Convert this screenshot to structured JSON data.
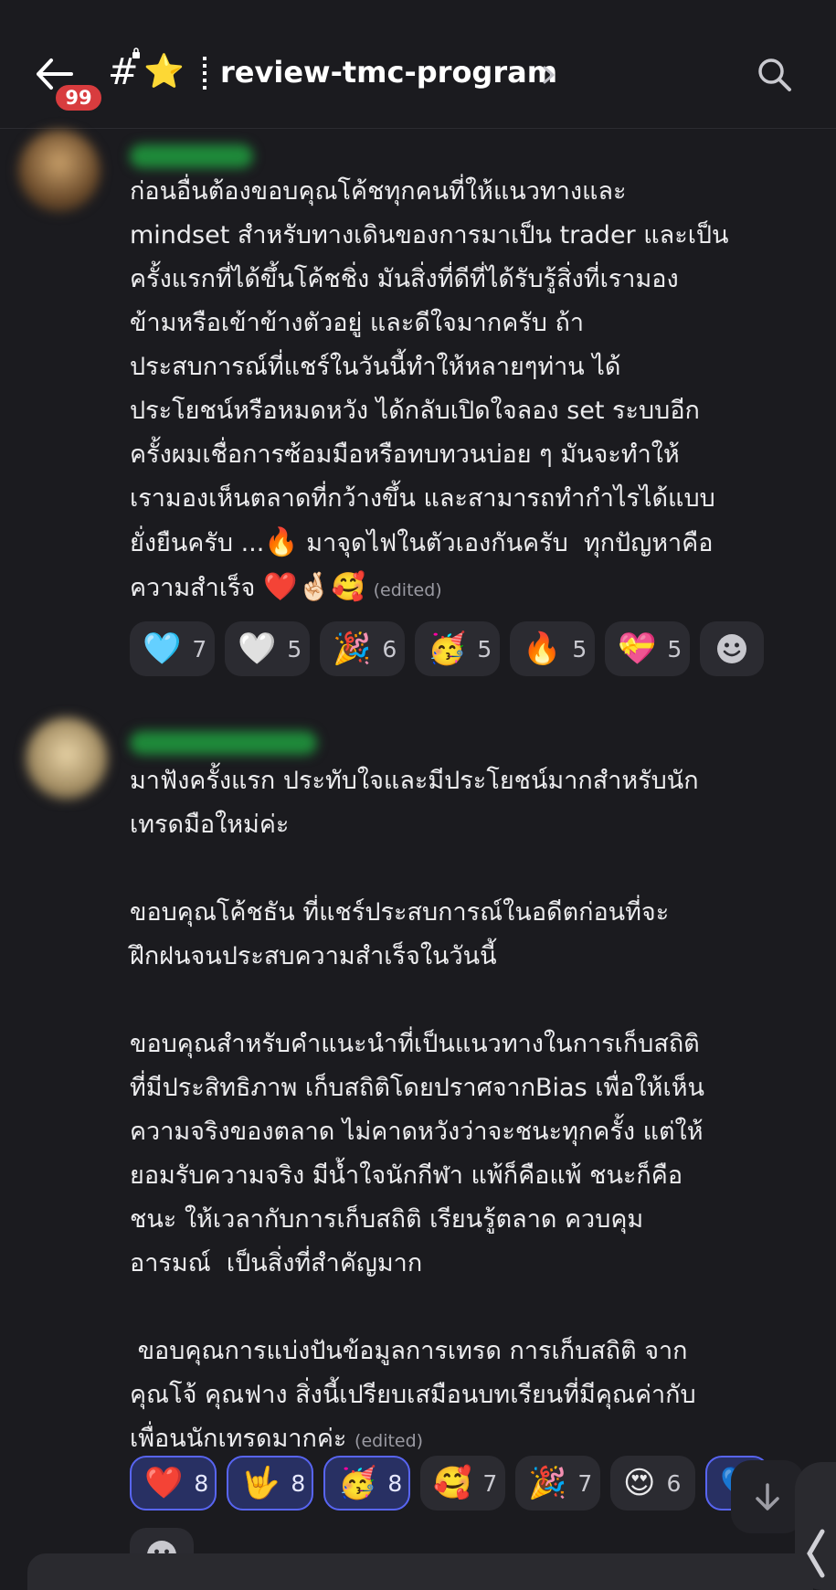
{
  "header": {
    "unread_badge": "99",
    "hash": "#",
    "channel_emoji": "⭐",
    "channel_name": "review-tmc-program",
    "icons": [
      "back-arrow-icon",
      "lock-icon",
      "chevron-right-icon",
      "search-icon"
    ]
  },
  "messages": [
    {
      "text": "ก่อนอื่นต้องขอบคุณโค้ชทุกคนที่ให้แนวทางและ\nmindset สำหรับทางเดินของการมาเป็น trader และเป็น\nครั้งแรกที่ได้ขึ้นโค้ชชิ่ง มันสิ่งที่ดีที่ได้รับรู้สิ่งที่เรามอง\nข้ามหรือเข้าข้างตัวอยู่ และดีใจมากครับ ถ้า\nประสบการณ์ที่แชร์ในวันนี้ทำให้หลายๆท่าน ได้\nประโยชน์หรือหมดหวัง ได้กลับเปิดใจลอง set ระบบอีก\nครั้งผมเชื่อการซ้อมมือหรือทบทวนบ่อย ๆ มันจะทำให้\nเรามองเห็นตลาดที่กว้างขึ้น และสามารถทำกำไรได้แบบ\nยั่งยืนครับ ...",
      "text_after_fire": " มาจุดไฟในตัวเองกันครับ  ทุกปัญหาคือ\nความสำเร็จ ",
      "trailing_emojis": "❤️🤞🏻🥰",
      "fire_emoji": "🔥",
      "edited": "(edited)",
      "reactions": [
        {
          "emoji": "🩵",
          "count": "7",
          "me": false
        },
        {
          "emoji": "🤍",
          "count": "5",
          "me": false
        },
        {
          "emoji": "🎉",
          "count": "6",
          "me": false
        },
        {
          "emoji": "🥳",
          "count": "5",
          "me": false
        },
        {
          "emoji": "🔥",
          "count": "5",
          "me": false
        },
        {
          "emoji": "💝",
          "count": "5",
          "me": false
        }
      ]
    },
    {
      "text": "มาฟังครั้งแรก ประทับใจและมีประโยชน์มากสำหรับนัก\nเทรดมือใหม่ค่ะ\n\nขอบคุณโค้ชธัน ที่แชร์ประสบการณ์ในอดีตก่อนที่จะ\nฝึกฝนจนประสบความสำเร็จในวันนี้\n\nขอบคุณสำหรับคำแนะนำที่เป็นแนวทางในการเก็บสถิติ\nที่มีประสิทธิภาพ เก็บสถิติโดยปราศจากBias เพื่อให้เห็น\nความจริงของตลาด ไม่คาดหวังว่าจะชนะทุกครั้ง แต่ให้\nยอมรับความจริง มีน้ำใจนักกีฬา แพ้ก็คือแพ้ ชนะก็คือ\nชนะ ให้เวลากับการเก็บสถิติ เรียนรู้ตลาด ควบคุม\nอารมณ์  เป็นสิ่งที่สำคัญมาก\n\n ขอบคุณการแบ่งปันข้อมูลการเทรด การเก็บสถิติ จาก\nคุณโจ้ คุณฟาง สิ่งนี้เปรียบเสมือนบทเรียนที่มีคุณค่ากับ\nเพื่อนนักเทรดมากค่ะ",
      "edited": "(edited)",
      "reactions": [
        {
          "emoji": "❤️",
          "count": "8",
          "me": true
        },
        {
          "emoji": "🤟",
          "count": "8",
          "me": true
        },
        {
          "emoji": "🥳",
          "count": "8",
          "me": true
        },
        {
          "emoji": "🥰",
          "count": "7",
          "me": false
        },
        {
          "emoji": "🎉",
          "count": "7",
          "me": false
        },
        {
          "emoji": "😍",
          "count": "6",
          "me": false
        },
        {
          "emoji": "💙",
          "count": "",
          "me": true
        }
      ]
    }
  ],
  "colors": {
    "background": "#1b1b1f",
    "pill": "#2b2b31",
    "pill_me": "#283063",
    "accent": "#5865f2",
    "badge": "#d83c3e"
  }
}
